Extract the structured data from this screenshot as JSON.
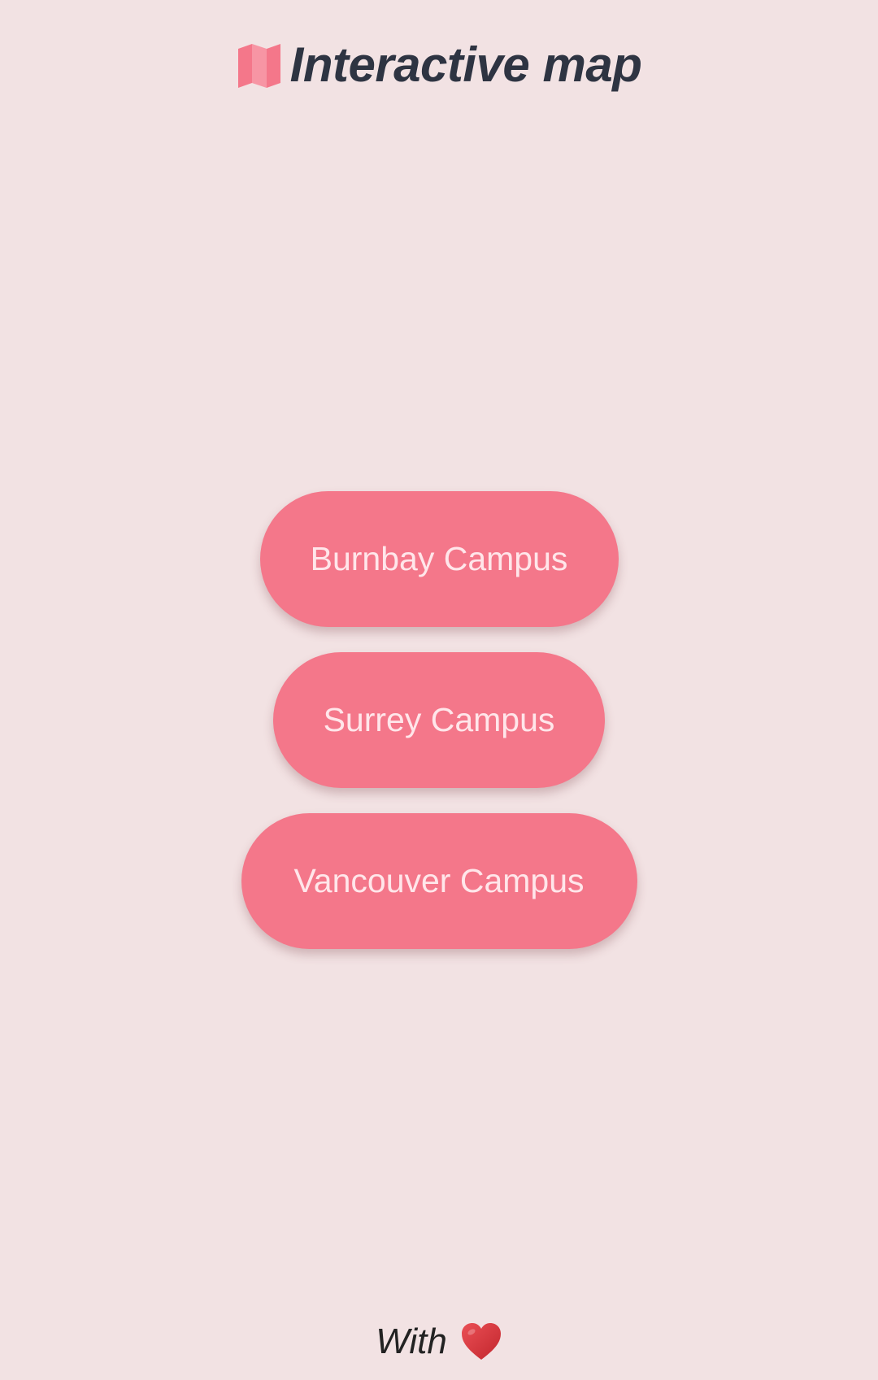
{
  "header": {
    "icon": "map-icon",
    "title": "Interactive map"
  },
  "campuses": [
    {
      "label": "Burnbay Campus"
    },
    {
      "label": "Surrey Campus"
    },
    {
      "label": "Vancouver Campus"
    }
  ],
  "footer": {
    "text": "With",
    "icon": "heart-icon"
  },
  "colors": {
    "background": "#f2e2e3",
    "accent": "#f4778a",
    "button_text": "#ffe6ea",
    "title": "#2e3442",
    "heart": "#d8393f"
  }
}
